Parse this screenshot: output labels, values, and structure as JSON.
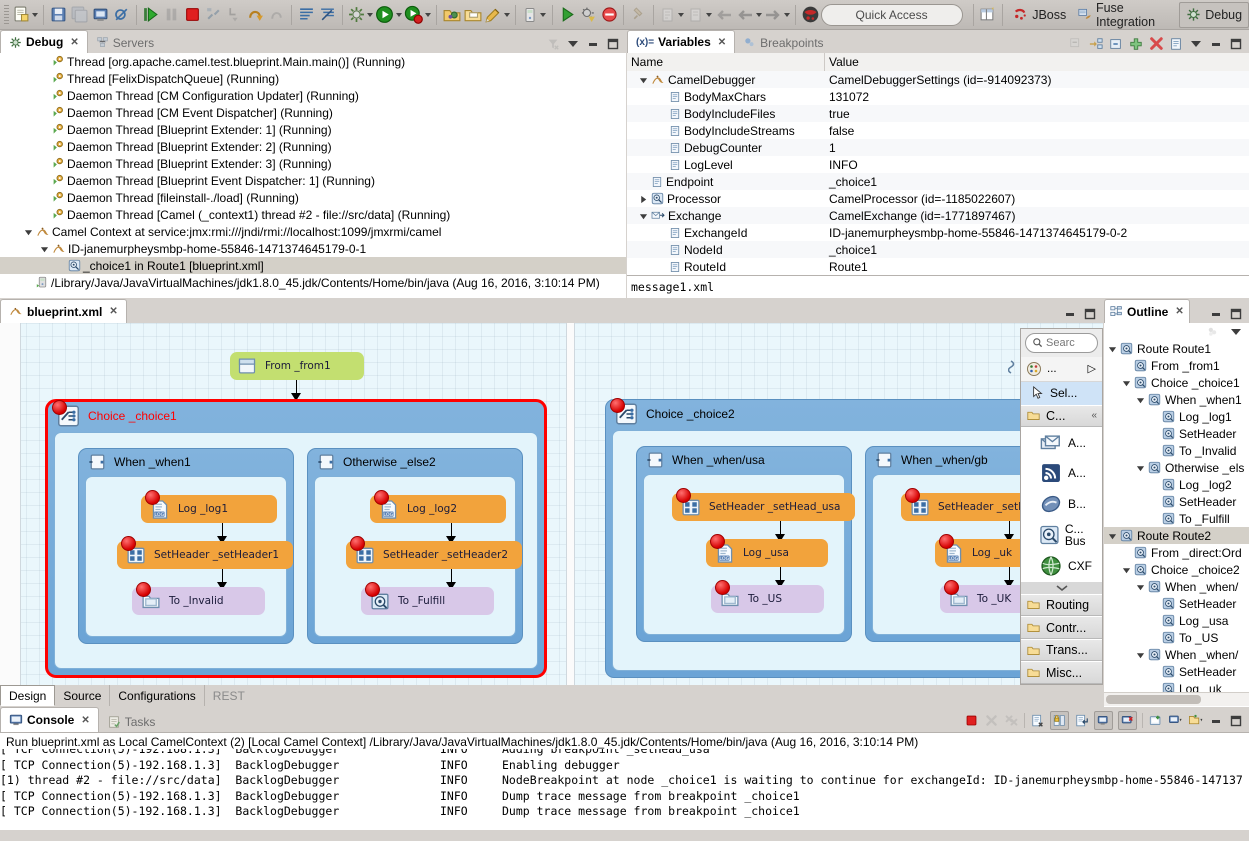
{
  "toolbar": {
    "icons": [
      "new-file-icon",
      "save-icon",
      "save-all-icon",
      "print-icon",
      "skip-breakpoints-icon",
      "resume-icon",
      "suspend-icon",
      "terminate-icon",
      "disconnect-icon",
      "step-into-icon",
      "step-over-icon",
      "step-return-icon",
      "drop-to-frame-icon",
      "use-step-filters-icon",
      "new-camel-xml-icon",
      "new-fuse-project-icon",
      "run-icon",
      "debug-icon",
      "profile-icon",
      "open-type-icon",
      "open-task-icon",
      "external-tools-icon",
      "server-icon",
      "run-as-icon",
      "debug-as-icon",
      "coverage-icon",
      "pin-icon",
      "annotation-prev-icon",
      "annotation-next-icon",
      "back-icon",
      "forward-icon",
      "jboss-central-icon"
    ],
    "quick_access_placeholder": "Quick Access",
    "perspectives": [
      {
        "name": "open-perspective",
        "label": ""
      },
      {
        "name": "perspective-jboss",
        "label": "JBoss"
      },
      {
        "name": "perspective-fuse-integration",
        "label": "Fuse Integration"
      },
      {
        "name": "perspective-debug",
        "label": "Debug"
      }
    ]
  },
  "debug_view": {
    "tabs": [
      {
        "label": "Debug",
        "active": true,
        "icon": "debug-icon"
      },
      {
        "label": "Servers",
        "active": false,
        "icon": "servers-icon"
      }
    ],
    "tools": [
      "view-menu-icon",
      "minimize-icon",
      "maximize-icon"
    ],
    "tree": [
      {
        "indent": 2,
        "icon": "thread-icon",
        "label": "Thread [org.apache.camel.test.blueprint.Main.main()] (Running)",
        "twist": "none",
        "selected": false
      },
      {
        "indent": 2,
        "icon": "thread-icon",
        "label": "Thread [FelixDispatchQueue] (Running)",
        "twist": "none",
        "selected": false
      },
      {
        "indent": 2,
        "icon": "thread-icon",
        "label": "Daemon Thread [CM Configuration Updater] (Running)",
        "twist": "none",
        "selected": false
      },
      {
        "indent": 2,
        "icon": "thread-icon",
        "label": "Daemon Thread [CM Event Dispatcher] (Running)",
        "twist": "none",
        "selected": false
      },
      {
        "indent": 2,
        "icon": "thread-icon",
        "label": "Daemon Thread [Blueprint Extender: 1] (Running)",
        "twist": "none",
        "selected": false
      },
      {
        "indent": 2,
        "icon": "thread-icon",
        "label": "Daemon Thread [Blueprint Extender: 2] (Running)",
        "twist": "none",
        "selected": false
      },
      {
        "indent": 2,
        "icon": "thread-icon",
        "label": "Daemon Thread [Blueprint Extender: 3] (Running)",
        "twist": "none",
        "selected": false
      },
      {
        "indent": 2,
        "icon": "thread-icon",
        "label": "Daemon Thread [Blueprint Event Dispatcher: 1] (Running)",
        "twist": "none",
        "selected": false
      },
      {
        "indent": 2,
        "icon": "thread-icon",
        "label": "Daemon Thread [fileinstall-./load] (Running)",
        "twist": "none",
        "selected": false
      },
      {
        "indent": 2,
        "icon": "thread-icon",
        "label": "Daemon Thread [Camel (_context1) thread #2 - file://src/data] (Running)",
        "twist": "none",
        "selected": false
      },
      {
        "indent": 1,
        "icon": "camel-icon",
        "label": "Camel Context at service:jmx:rmi:///jndi/rmi://localhost:1099/jmxrmi/camel",
        "twist": "down",
        "selected": false
      },
      {
        "indent": 2,
        "icon": "camel-icon",
        "label": "ID-janemurpheysmbp-home-55846-1471374645179-0-1",
        "twist": "down",
        "selected": false
      },
      {
        "indent": 3,
        "icon": "processor-icon",
        "label": "_choice1 in Route1 [blueprint.xml]",
        "twist": "none",
        "selected": true
      },
      {
        "indent": 1,
        "icon": "jvm-icon",
        "label": "/Library/Java/JavaVirtualMachines/jdk1.8.0_45.jdk/Contents/Home/bin/java (Aug 16, 2016, 3:10:14 PM)",
        "twist": "none",
        "selected": false
      }
    ]
  },
  "variables_view": {
    "tabs": [
      {
        "label": "Variables",
        "active": true,
        "icon": "variables-icon"
      },
      {
        "label": "Breakpoints",
        "active": false,
        "icon": "breakpoints-icon"
      }
    ],
    "tools": [
      "collapse-all-icon",
      "show-logical-structure-icon",
      "collapse-icon",
      "add-icon",
      "remove-icon",
      "details-icon",
      "view-menu-icon",
      "minimize-icon",
      "maximize-icon"
    ],
    "columns": [
      "Name",
      "Value"
    ],
    "rows": [
      {
        "indent": 0,
        "twist": "down",
        "icon": "camel-icon",
        "name": "CamelDebugger",
        "value": "CamelDebuggerSettings (id=-914092373)"
      },
      {
        "indent": 1,
        "twist": "none",
        "icon": "field-icon",
        "name": "BodyMaxChars",
        "value": "131072"
      },
      {
        "indent": 1,
        "twist": "none",
        "icon": "field-icon",
        "name": "BodyIncludeFiles",
        "value": "true"
      },
      {
        "indent": 1,
        "twist": "none",
        "icon": "field-icon",
        "name": "BodyIncludeStreams",
        "value": "false"
      },
      {
        "indent": 1,
        "twist": "none",
        "icon": "field-icon",
        "name": "DebugCounter",
        "value": "1"
      },
      {
        "indent": 1,
        "twist": "none",
        "icon": "field-icon",
        "name": "LogLevel",
        "value": "INFO"
      },
      {
        "indent": 0,
        "twist": "none",
        "icon": "field-icon",
        "name": "Endpoint",
        "value": "_choice1"
      },
      {
        "indent": 0,
        "twist": "right",
        "icon": "processor-icon",
        "name": "Processor",
        "value": "CamelProcessor (id=-1185022607)"
      },
      {
        "indent": 0,
        "twist": "down",
        "icon": "exchange-icon",
        "name": "Exchange",
        "value": "CamelExchange (id=-1771897467)"
      },
      {
        "indent": 1,
        "twist": "none",
        "icon": "field-icon",
        "name": "ExchangeId",
        "value": "ID-janemurpheysmbp-home-55846-1471374645179-0-2"
      },
      {
        "indent": 1,
        "twist": "none",
        "icon": "field-icon",
        "name": "NodeId",
        "value": "_choice1"
      },
      {
        "indent": 1,
        "twist": "none",
        "icon": "field-icon",
        "name": "RouteId",
        "value": "Route1"
      }
    ],
    "detail_pane": "message1.xml"
  },
  "editor": {
    "tab": {
      "label": "blueprint.xml",
      "icon": "camel-icon",
      "close": "✕"
    },
    "tools": [
      "minimize-icon",
      "maximize-icon"
    ],
    "bottom_tabs": [
      {
        "label": "Design",
        "active": true,
        "dim": false
      },
      {
        "label": "Source",
        "active": false,
        "dim": false
      },
      {
        "label": "Configurations",
        "active": false,
        "dim": false
      },
      {
        "label": "REST",
        "active": false,
        "dim": true
      }
    ],
    "diagram": {
      "from": {
        "label": "From _from1",
        "icon": "endpoint-file-icon",
        "color": "#c3df70"
      },
      "route1": {
        "label": "Choice _choice1",
        "selected": true,
        "label_color": "#ff0000",
        "branches": [
          {
            "label": "When _when1",
            "icon": "when-icon",
            "steps": [
              {
                "label": "Log _log1",
                "icon": "log-icon",
                "color": "orange"
              },
              {
                "label": "SetHeader _setHeader1",
                "icon": "setheader-icon",
                "color": "orange"
              },
              {
                "label": "To _Invalid",
                "icon": "endpoint-file-icon",
                "color": "purple"
              }
            ]
          },
          {
            "label": "Otherwise _else2",
            "icon": "when-icon",
            "steps": [
              {
                "label": "Log _log2",
                "icon": "log-icon",
                "color": "orange"
              },
              {
                "label": "SetHeader _setHeader2",
                "icon": "setheader-icon",
                "color": "orange"
              },
              {
                "label": "To _Fulfill",
                "icon": "endpoint-bean-icon",
                "color": "purple"
              }
            ]
          }
        ]
      },
      "route2": {
        "label": "Choice _choice2",
        "selected": false,
        "branches": [
          {
            "label": "When _when/usa",
            "icon": "when-icon",
            "steps": [
              {
                "label": "SetHeader _setHead_usa",
                "icon": "setheader-icon",
                "color": "orange"
              },
              {
                "label": "Log _usa",
                "icon": "log-icon",
                "color": "orange"
              },
              {
                "label": "To _US",
                "icon": "endpoint-file-icon",
                "color": "purple"
              }
            ]
          },
          {
            "label": "When _when/gb",
            "icon": "when-icon",
            "steps": [
              {
                "label": "SetHeader _setHead_u",
                "icon": "setheader-icon",
                "color": "orange"
              },
              {
                "label": "Log _uk",
                "icon": "log-icon",
                "color": "orange"
              },
              {
                "label": "To _UK",
                "icon": "endpoint-file-icon",
                "color": "purple"
              }
            ]
          }
        ]
      }
    },
    "palette": {
      "search_placeholder": "Searc",
      "header": {
        "label": "...",
        "icon": "palette-icon",
        "arrow": "▷"
      },
      "select_item": {
        "label": "Sel...",
        "icon": "cursor-icon"
      },
      "components_group": {
        "label": "C...",
        "icon": "folder-icon",
        "collapse": "«"
      },
      "items": [
        {
          "label": "A...",
          "icon": "amqp-icon"
        },
        {
          "label": "A...",
          "icon": "atom-icon"
        },
        {
          "label": "B...",
          "icon": "bean-icon"
        },
        {
          "label": "C... Bus",
          "icon": "cxfbus-icon"
        },
        {
          "label": "CXF",
          "icon": "cxf-icon"
        }
      ],
      "groups": [
        {
          "label": "Routing",
          "icon": "folder-icon"
        },
        {
          "label": "Contr...",
          "icon": "folder-icon"
        },
        {
          "label": "Trans...",
          "icon": "folder-icon"
        },
        {
          "label": "Misc...",
          "icon": "folder-icon"
        }
      ]
    }
  },
  "outline_view": {
    "tabs": [
      {
        "label": "Outline",
        "active": true,
        "icon": "outline-icon"
      }
    ],
    "tools": [
      "minimize-icon",
      "maximize-icon",
      "sort-icon",
      "view-menu-icon"
    ],
    "tree": [
      {
        "indent": 0,
        "twist": "down",
        "label": "Route Route1",
        "selected": false
      },
      {
        "indent": 1,
        "twist": "none",
        "label": "From _from1",
        "selected": false
      },
      {
        "indent": 1,
        "twist": "down",
        "label": "Choice _choice1",
        "selected": false
      },
      {
        "indent": 2,
        "twist": "down",
        "label": "When _when1",
        "selected": false
      },
      {
        "indent": 3,
        "twist": "none",
        "label": "Log _log1",
        "selected": false
      },
      {
        "indent": 3,
        "twist": "none",
        "label": "SetHeader",
        "selected": false
      },
      {
        "indent": 3,
        "twist": "none",
        "label": "To _Invalid",
        "selected": false
      },
      {
        "indent": 2,
        "twist": "down",
        "label": "Otherwise _els",
        "selected": false
      },
      {
        "indent": 3,
        "twist": "none",
        "label": "Log _log2",
        "selected": false
      },
      {
        "indent": 3,
        "twist": "none",
        "label": "SetHeader",
        "selected": false
      },
      {
        "indent": 3,
        "twist": "none",
        "label": "To _Fulfill",
        "selected": false
      },
      {
        "indent": 0,
        "twist": "down",
        "label": "Route Route2",
        "selected": true
      },
      {
        "indent": 1,
        "twist": "none",
        "label": "From _direct:Ord",
        "selected": false
      },
      {
        "indent": 1,
        "twist": "down",
        "label": "Choice _choice2",
        "selected": false
      },
      {
        "indent": 2,
        "twist": "down",
        "label": "When _when/",
        "selected": false
      },
      {
        "indent": 3,
        "twist": "none",
        "label": "SetHeader",
        "selected": false
      },
      {
        "indent": 3,
        "twist": "none",
        "label": "Log _usa",
        "selected": false
      },
      {
        "indent": 3,
        "twist": "none",
        "label": "To _US",
        "selected": false
      },
      {
        "indent": 2,
        "twist": "down",
        "label": "When _when/",
        "selected": false
      },
      {
        "indent": 3,
        "twist": "none",
        "label": "SetHeader",
        "selected": false
      },
      {
        "indent": 3,
        "twist": "none",
        "label": "Log _uk",
        "selected": false
      }
    ]
  },
  "console_view": {
    "tabs": [
      {
        "label": "Console",
        "active": true,
        "icon": "console-icon"
      },
      {
        "label": "Tasks",
        "active": false,
        "icon": "tasks-icon"
      }
    ],
    "tools": [
      "terminate-icon",
      "remove-launch-icon",
      "remove-all-launches-icon",
      "clear-console-icon",
      "scroll-lock-icon",
      "word-wrap-icon",
      "show-console-icon",
      "pin-console-icon",
      "display-selected-console-icon",
      "open-console-icon",
      "minimize-icon",
      "maximize-icon"
    ],
    "summary": "Run blueprint.xml as Local CamelContext (2) [Local Camel Context] /Library/Java/JavaVirtualMachines/jdk1.8.0_45.jdk/Contents/Home/bin/java (Aug 16, 2016, 3:10:14 PM)",
    "lines": [
      {
        "thread": "[ TCP Connection(5)-192.168.1.3]",
        "logger": "BacklogDebugger",
        "level": "INFO",
        "message": "Adding breakpoint _setHead_usa",
        "clipped": true
      },
      {
        "thread": "[ TCP Connection(5)-192.168.1.3]",
        "logger": "BacklogDebugger",
        "level": "INFO",
        "message": "Enabling debugger",
        "clipped": false
      },
      {
        "thread": "[1) thread #2 - file://src/data]",
        "logger": "BacklogDebugger",
        "level": "INFO",
        "message": "NodeBreakpoint at node _choice1 is waiting to continue for exchangeId: ID-janemurpheysmbp-home-55846-147137",
        "clipped": false
      },
      {
        "thread": "[ TCP Connection(5)-192.168.1.3]",
        "logger": "BacklogDebugger",
        "level": "INFO",
        "message": "Dump trace message from breakpoint _choice1",
        "clipped": false
      },
      {
        "thread": "[ TCP Connection(5)-192.168.1.3]",
        "logger": "BacklogDebugger",
        "level": "INFO",
        "message": "Dump trace message from breakpoint _choice1",
        "clipped": false
      }
    ]
  }
}
